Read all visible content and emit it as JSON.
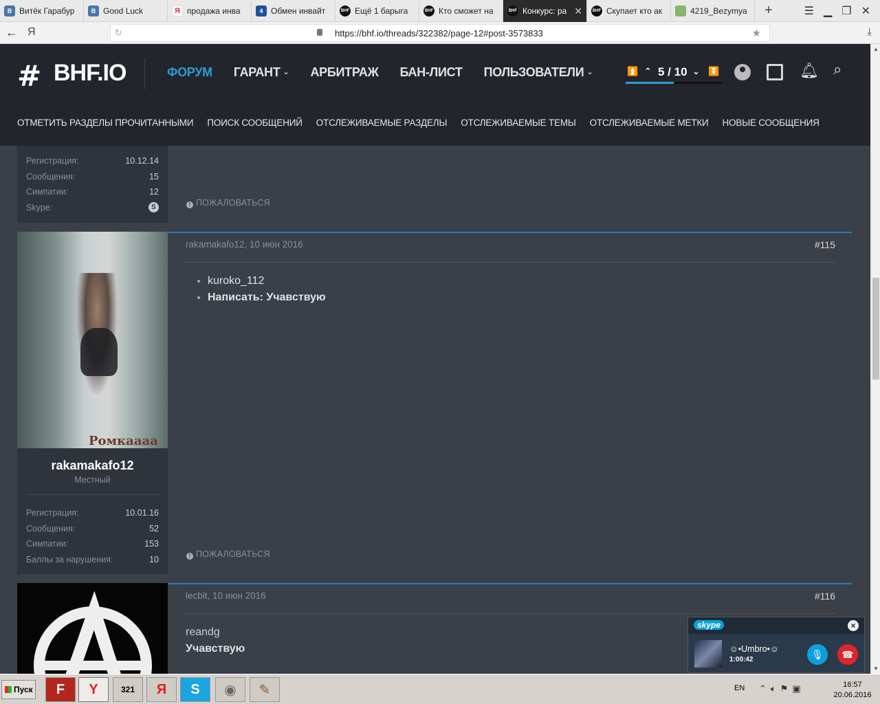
{
  "browser": {
    "tabs": [
      {
        "label": "Витёк Гарабур",
        "icon": "vk-icon",
        "fav": "B"
      },
      {
        "label": "Good Luck",
        "icon": "vk-icon",
        "fav": "B"
      },
      {
        "label": "продажа инва",
        "icon": "yandex-icon",
        "fav": "Я"
      },
      {
        "label": "Обмен инвайт",
        "icon": "four-icon",
        "fav": "4"
      },
      {
        "label": "Ещё 1 барыга",
        "icon": "bhf-icon",
        "fav": "BHF"
      },
      {
        "label": "Кто сможет на",
        "icon": "bhf-icon",
        "fav": "BHF"
      },
      {
        "label": "Конкурс: ра",
        "icon": "bhf-icon",
        "fav": "BHF",
        "active": true
      },
      {
        "label": "Скупает кто ак",
        "icon": "bhf-icon",
        "fav": "BHF"
      },
      {
        "label": "4219_Bezymya",
        "icon": "image-icon",
        "fav": ""
      }
    ],
    "address_letter": "Я",
    "url": "https://bhf.io/threads/322382/page-12#post-3573833"
  },
  "site": {
    "logo_hash": "#",
    "logo_text": "BHF.IO",
    "nav": [
      {
        "label": "ФОРУМ",
        "active": true,
        "dropdown": false
      },
      {
        "label": "ГАРАНТ",
        "active": false,
        "dropdown": true
      },
      {
        "label": "АРБИТРАЖ",
        "active": false,
        "dropdown": false
      },
      {
        "label": "БАН-ЛИСТ",
        "active": false,
        "dropdown": false
      },
      {
        "label": "ПОЛЬЗОВАТЕЛИ",
        "active": false,
        "dropdown": true
      }
    ],
    "pager": {
      "text": "5 / 10",
      "current": 5,
      "total": 10
    },
    "subnav": [
      "ОТМЕТИТЬ РАЗДЕЛЫ ПРОЧИТАННЫМИ",
      "ПОИСК СООБЩЕНИЙ",
      "ОТСЛЕЖИВАЕМЫЕ РАЗДЕЛЫ",
      "ОТСЛЕЖИВАЕМЫЕ ТЕМЫ",
      "ОТСЛЕЖИВАЕМЫЕ МЕТКИ",
      "НОВЫЕ СООБЩЕНИЯ"
    ],
    "accent": "#2e9ad7"
  },
  "posts": {
    "prev": {
      "stats": [
        {
          "label": "Регистрация:",
          "value": "10.12.14"
        },
        {
          "label": "Сообщения:",
          "value": "15"
        },
        {
          "label": "Симпатии:",
          "value": "12"
        },
        {
          "label": "Skype:",
          "value": ""
        }
      ],
      "complain": "ПОЖАЛОВАТЬСЯ"
    },
    "p115": {
      "photo_caption": "Ромкаааа",
      "username": "rakamakafo12",
      "usertitle": "Местный",
      "meta": "rakamakafo12, 10 июн 2016",
      "number": "#115",
      "list": [
        "kuroko_112",
        "Написать: Учавствую"
      ],
      "stats": [
        {
          "label": "Регистрация:",
          "value": "10.01.16"
        },
        {
          "label": "Сообщения:",
          "value": "52"
        },
        {
          "label": "Симпатии:",
          "value": "153"
        },
        {
          "label": "Баллы за нарушения:",
          "value": "10"
        }
      ],
      "complain": "ПОЖАЛОВАТЬСЯ"
    },
    "p116": {
      "meta": "lecbit, 10 июн 2016",
      "number": "#116",
      "line1": "reandg",
      "line2": "Учавствую"
    }
  },
  "skype": {
    "logo": "skype",
    "name": "☺•Umbro•☺",
    "time": "1:00:42"
  },
  "taskbar": {
    "start": "Пуск",
    "lang": "EN",
    "time": "16:57",
    "date": "20.06.2016"
  }
}
